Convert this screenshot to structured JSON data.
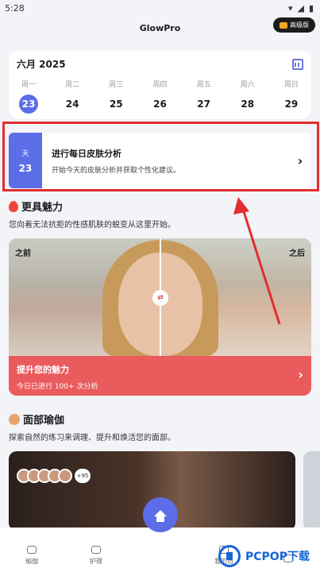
{
  "status": {
    "time": "5:28"
  },
  "app": {
    "title": "GlowPro",
    "premium_label": "高级版"
  },
  "calendar": {
    "month": "六月 2025",
    "days": [
      {
        "name": "周一",
        "num": "23"
      },
      {
        "name": "周二",
        "num": "24"
      },
      {
        "name": "周三",
        "num": "25"
      },
      {
        "name": "周四",
        "num": "26"
      },
      {
        "name": "周五",
        "num": "27"
      },
      {
        "name": "周六",
        "num": "28"
      },
      {
        "name": "周日",
        "num": "29"
      }
    ]
  },
  "daily": {
    "chip_label": "天",
    "chip_num": "23",
    "title": "进行每日皮肤分析",
    "subtitle": "开始今天的皮肤分析并获取个性化建议。"
  },
  "beauty": {
    "title": "更具魅力",
    "subtitle": "您向着无法抗拒的性感肌肤的蜕变从这里开始。",
    "before": "之前",
    "after": "之后",
    "cta_title": "提升您的魅力",
    "cta_subtitle": "今日已进行 100+ 次分析"
  },
  "yoga": {
    "title": "面部瑜伽",
    "subtitle": "探索自然的练习来调理、提升和焕活您的面部。",
    "avatar_count": "+95"
  },
  "nav": {
    "items": [
      {
        "label": "瑜伽"
      },
      {
        "label": "护理"
      },
      {
        "label": "我的日"
      },
      {
        "label": ""
      }
    ]
  },
  "watermark": {
    "text": "PCPOP下载"
  },
  "colors": {
    "accent": "#5b6ee8",
    "highlight": "#e12e2e",
    "cta": "#ea5b5d"
  }
}
